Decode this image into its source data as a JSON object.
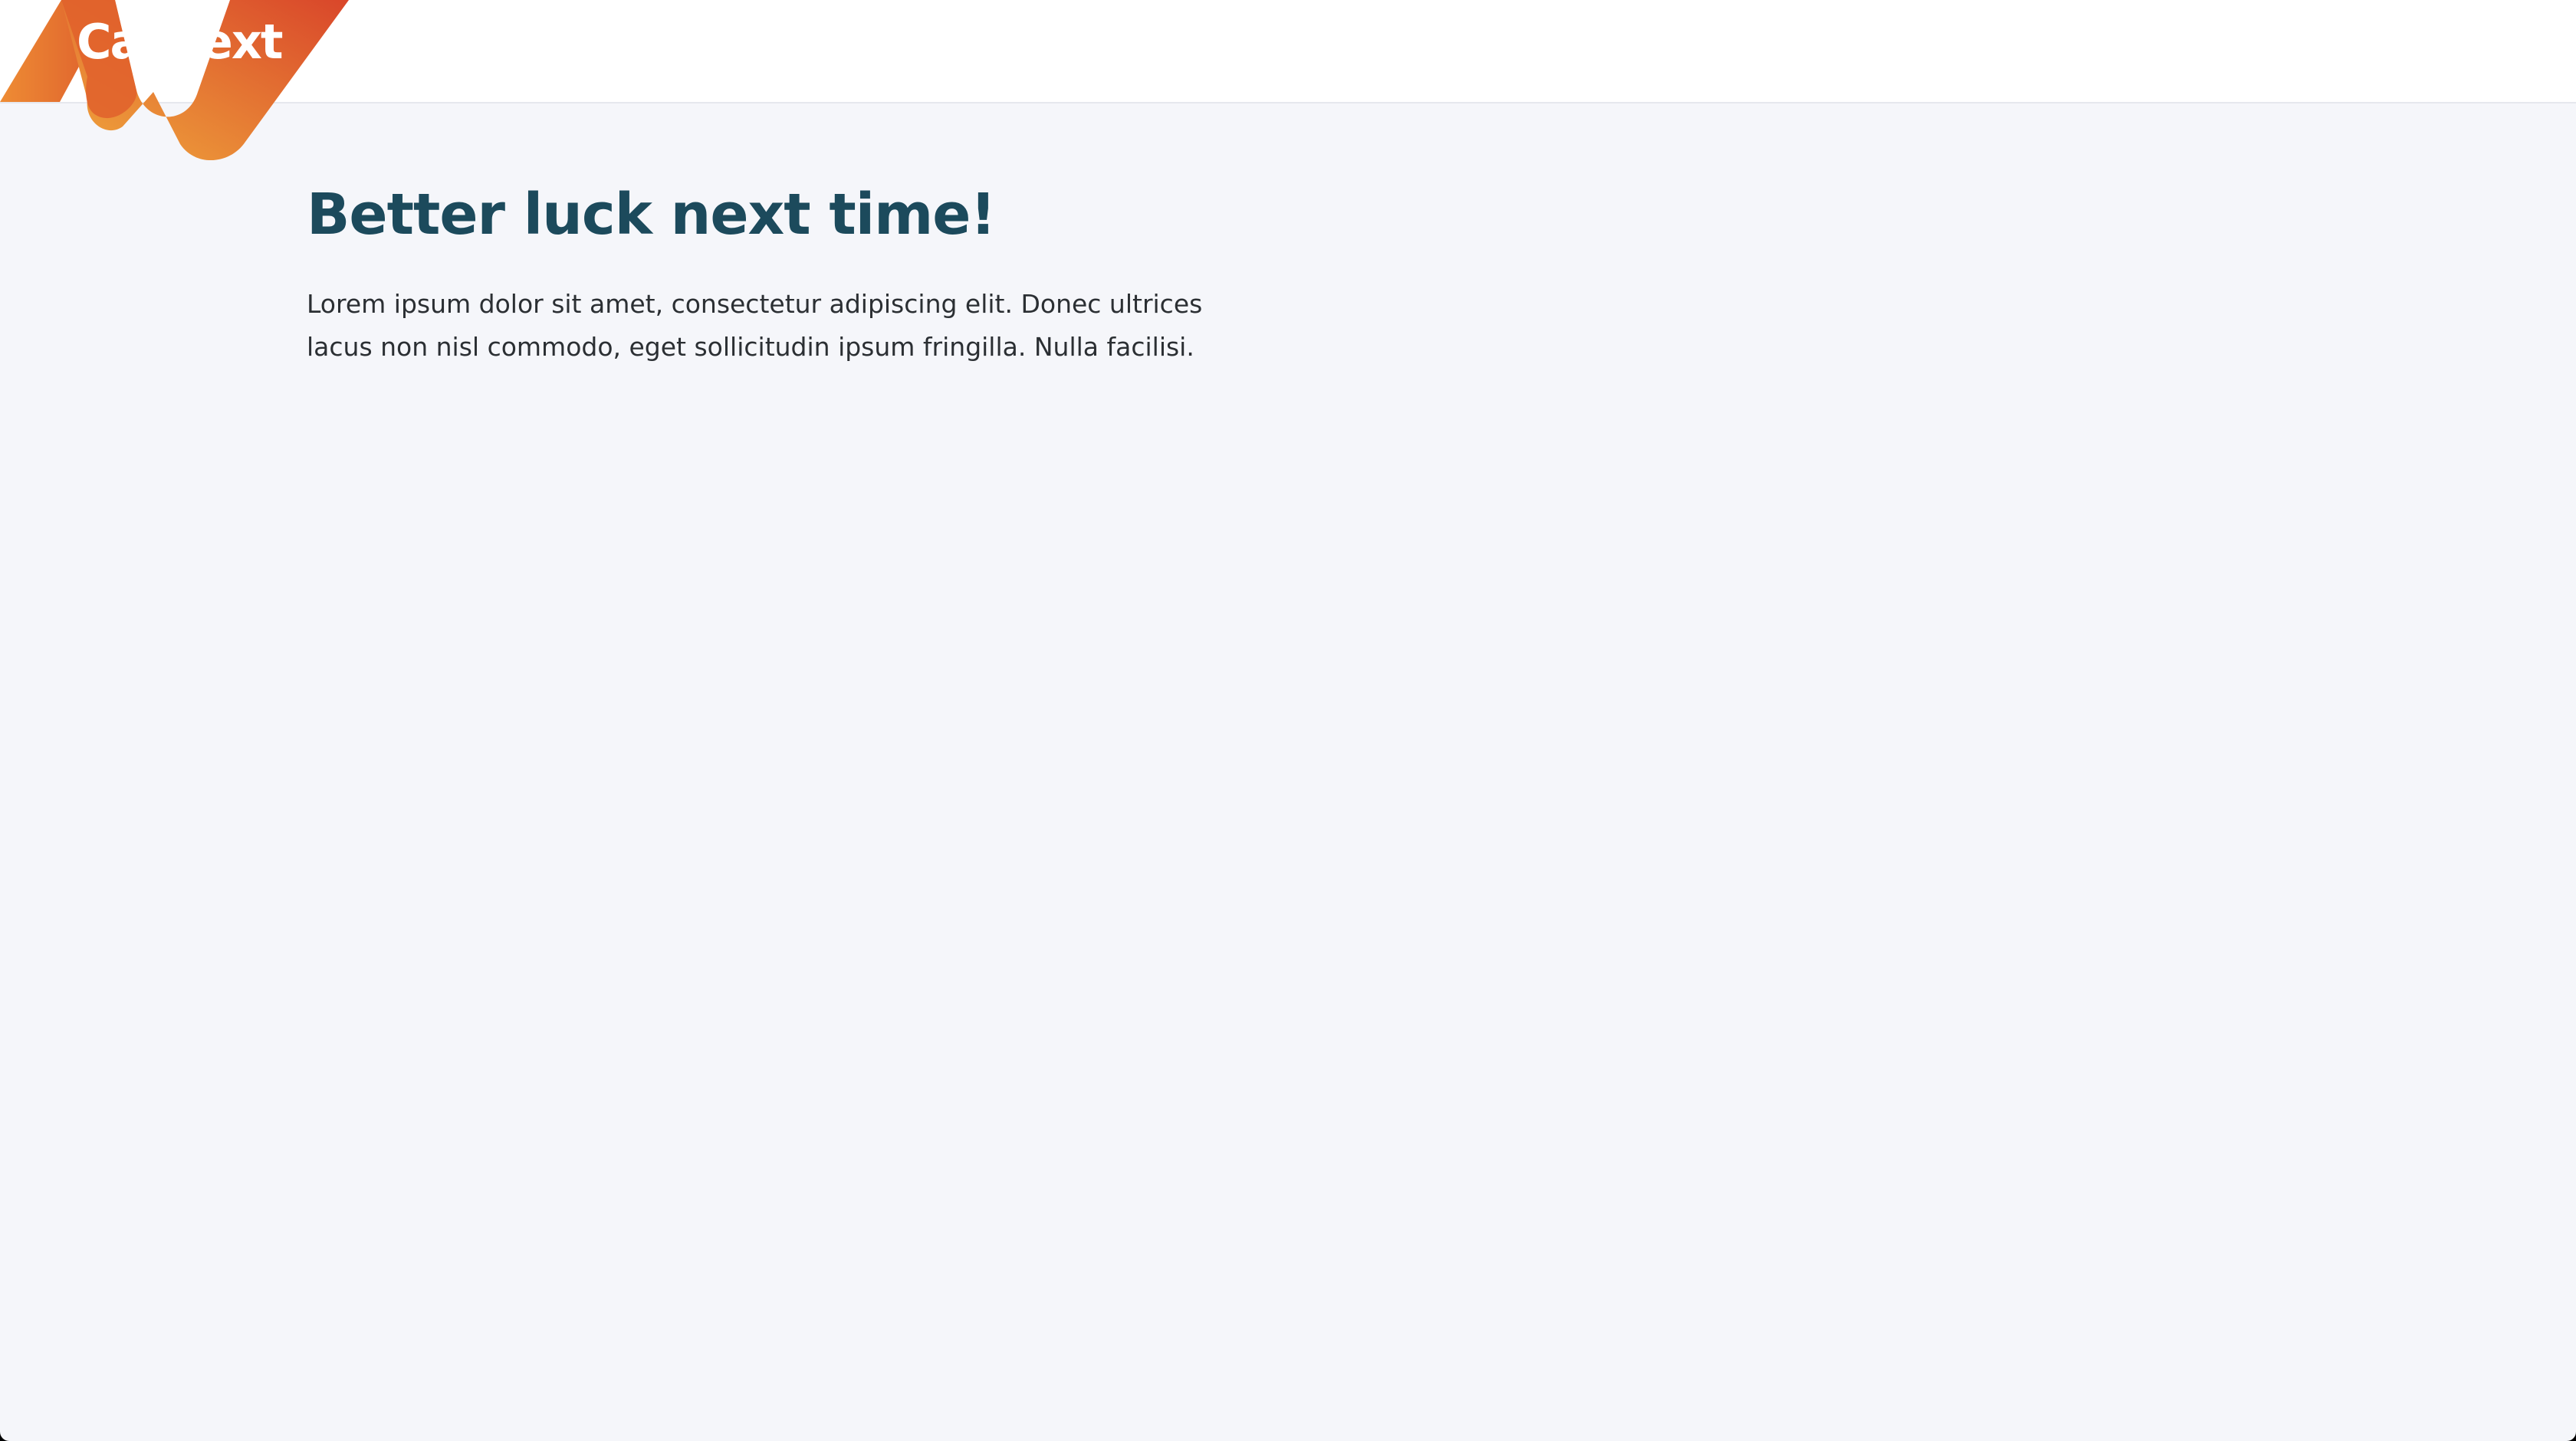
{
  "header": {
    "logo_text": "CarNext",
    "brand_colors": {
      "orange_light": "#f0a03a",
      "orange_dark": "#d84a2b"
    }
  },
  "main": {
    "title": "Better luck next time!",
    "body": "Lorem ipsum dolor sit amet, consectetur adipiscing elit. Donec ultrices lacus non nisl commodo, eget sollicitudin ipsum fringilla. Nulla facilisi."
  },
  "colors": {
    "background": "#f5f6fa",
    "header_background": "#ffffff",
    "title": "#1c4a5c",
    "text": "#2b2f33"
  }
}
